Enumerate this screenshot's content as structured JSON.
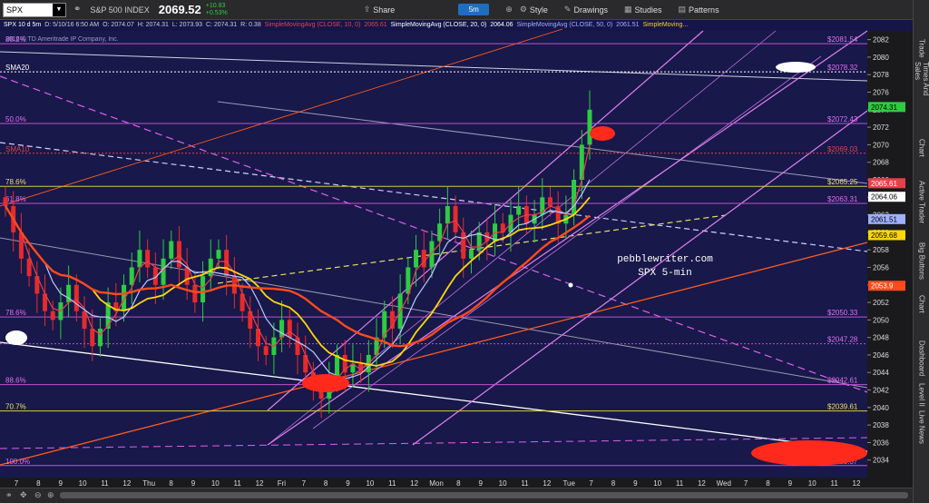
{
  "toolbar": {
    "symbol": "SPX",
    "index_name": "S&P 500 INDEX",
    "price": "2069.52",
    "change_abs": "+10.83",
    "change_pct": "+0.53%",
    "share": "Share",
    "timeframe": "5m",
    "style": "Style",
    "drawings": "Drawings",
    "studies": "Studies",
    "patterns": "Patterns"
  },
  "info_line": {
    "desc": "SPX 10 d 5m",
    "date": "D: 5/10/16 6:50 AM",
    "o": "O: 2074.07",
    "h": "H: 2074.31",
    "l": "L: 2073.93",
    "c": "C: 2074.31",
    "r": "R: 0.38",
    "sma10": "SimpleMovingAvg (CLOSE, 10, 0)",
    "sma10_val": "2065.61",
    "sma20": "SimpleMovingAvg (CLOSE, 20, 0)",
    "sma20_val": "2064.06",
    "sma50": "SimpleMovingAvg (CLOSE, 50, 0)",
    "sma50_val": "2061.51",
    "sma_extra": "SimpleMoving..."
  },
  "copyright": "2016 © TD Ameritrade IP Company, Inc.",
  "sidebar_tabs": [
    "Trade",
    "Times And Sales",
    "Chart",
    "Active Trader",
    "Big Buttons",
    "Chart",
    "Dashboard",
    "Level II",
    "Live News"
  ],
  "watermark": {
    "line1": "pebblewriter.com",
    "line2": "SPX 5-min"
  },
  "colors": {
    "bg": "#18184a",
    "candle_up": "#2ecc40",
    "candle_down": "#e62b2b",
    "sma10": "#e8404a",
    "sma20": "#b9c8ff",
    "sma50": "#ffd60a",
    "sma200": "#ff4a1c",
    "channel": "#e060f0",
    "fib": "#c050d0"
  },
  "chart_data": {
    "type": "candlestick",
    "ylim": [
      2032,
      2083
    ],
    "y_ticks": [
      2034,
      2036,
      2038,
      2040,
      2042,
      2044,
      2046,
      2048,
      2050,
      2052,
      2054,
      2056,
      2058,
      2060,
      2062,
      2064,
      2066,
      2068,
      2070,
      2072,
      2074,
      2076,
      2078,
      2080,
      2082
    ],
    "x_ticks": [
      "7",
      "8",
      "9",
      "10",
      "11",
      "12",
      "Thu",
      "8",
      "9",
      "10",
      "11",
      "12",
      "Fri",
      "7",
      "8",
      "9",
      "10",
      "11",
      "12",
      "Mon",
      "8",
      "9",
      "10",
      "11",
      "12",
      "Tue",
      "7",
      "8",
      "9",
      "10",
      "11",
      "12",
      "Wed",
      "7",
      "8",
      "9",
      "10",
      "11",
      "12"
    ],
    "levels": [
      {
        "label": "$2081.54",
        "value": 2081.54,
        "left_label": "88.2%",
        "style": "fib"
      },
      {
        "label": "$2078.32",
        "value": 2078.32,
        "left_label": "SMA20",
        "style": "white-dotted"
      },
      {
        "label": "$2072.43",
        "value": 2072.43,
        "left_label": "50.0%",
        "style": "fib"
      },
      {
        "label": "$2069.03",
        "value": 2069.03,
        "left_label": "SMA10",
        "style": "red-dotted"
      },
      {
        "label": "$2065.25",
        "value": 2065.25,
        "left_label": "78.6%",
        "style": "yellow"
      },
      {
        "label": "$2063.31",
        "value": 2063.31,
        "left_label": "61.8%",
        "style": "fib"
      },
      {
        "label": "$2050.33",
        "value": 2050.33,
        "left_label": "78.6%",
        "style": "fib"
      },
      {
        "label": "$2047.28",
        "value": 2047.28,
        "left_label": "",
        "style": "fib-dotted"
      },
      {
        "label": "$2042.61",
        "value": 2042.61,
        "left_label": "88.6%",
        "style": "fib"
      },
      {
        "label": "$2039.61",
        "value": 2039.61,
        "left_label": "70.7%",
        "style": "yellow"
      },
      {
        "label": "$2033.37",
        "value": 2033.37,
        "left_label": "100.0%",
        "style": "fib"
      }
    ],
    "price_badges": [
      {
        "label": "2074.31",
        "value": 2074.31,
        "color": "#2ecc40"
      },
      {
        "label": "2065.61",
        "value": 2065.61,
        "color": "#e8404a"
      },
      {
        "label": "2064.06",
        "value": 2064.06,
        "color": "#ffffff"
      },
      {
        "label": "2061.51",
        "value": 2061.51,
        "color": "#9fb0ff"
      },
      {
        "label": "2059.68",
        "value": 2059.68,
        "color": "#ffd60a"
      },
      {
        "label": "2053.9",
        "value": 2053.9,
        "color": "#ff4a1c"
      }
    ],
    "close_path": [
      2063,
      2060,
      2057,
      2055,
      2053,
      2051,
      2050,
      2052,
      2054,
      2051,
      2049,
      2047,
      2049,
      2052,
      2051,
      2054,
      2056,
      2058,
      2056,
      2054,
      2057,
      2059,
      2056,
      2054,
      2052,
      2055,
      2057,
      2058,
      2055,
      2053,
      2051,
      2049,
      2047,
      2046,
      2048,
      2050,
      2048,
      2046,
      2044,
      2042,
      2041,
      2043,
      2046,
      2044,
      2045,
      2044,
      2046,
      2048,
      2051,
      2049,
      2053,
      2056,
      2058,
      2056,
      2059,
      2061,
      2063,
      2060,
      2057,
      2058,
      2060,
      2059,
      2061,
      2060,
      2062,
      2063,
      2061,
      2062,
      2064,
      2063,
      2061,
      2062,
      2066,
      2070,
      2074
    ]
  }
}
